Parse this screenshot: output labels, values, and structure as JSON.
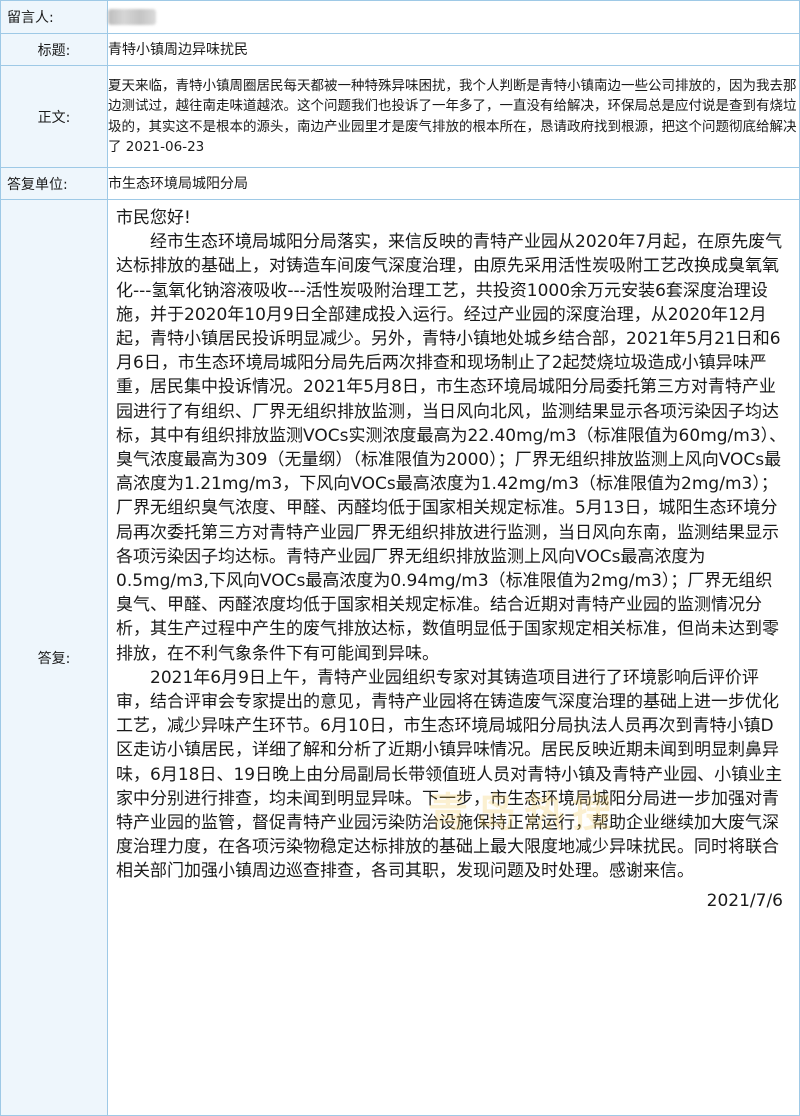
{
  "rows": {
    "author": {
      "label": "留言人:"
    },
    "title": {
      "label": "标题:",
      "value": "青特小镇周边异味扰民"
    },
    "content": {
      "label": "正文:",
      "value": "夏天来临，青特小镇周圈居民每天都被一种特殊异味困扰，我个人判断是青特小镇南边一些公司排放的，因为我去那边测试过，越往南走味道越浓。这个问题我们也投诉了一年多了，一直没有给解决，环保局总是应付说是查到有烧垃圾的，其实这不是根本的源头，南边产业园里才是废气排放的根本所在，恳请政府找到根源，把这个问题彻底给解决了  2021-06-23"
    },
    "unit": {
      "label": "答复单位:",
      "value": "市生态环境局城阳分局"
    },
    "reply": {
      "label": "答复:",
      "greeting": "市民您好!",
      "paragraph1": "经市生态环境局城阳分局落实，来信反映的青特产业园从2020年7月起，在原先废气达标排放的基础上，对铸造车间废气深度治理，由原先采用活性炭吸附工艺改换成臭氧氧化---氢氧化钠溶液吸收---活性炭吸附治理工艺，共投资1000余万元安装6套深度治理设施，并于2020年10月9日全部建成投入运行。经过产业园的深度治理，从2020年12月起，青特小镇居民投诉明显减少。另外，青特小镇地处城乡结合部，2021年5月21日和6月6日，市生态环境局城阳分局先后两次排查和现场制止了2起焚烧垃圾造成小镇异味严重，居民集中投诉情况。2021年5月8日，市生态环境局城阳分局委托第三方对青特产业园进行了有组织、厂界无组织排放监测，当日风向北风，监测结果显示各项污染因子均达标，其中有组织排放监测VOCs实测浓度最高为22.40mg/m3（标准限值为60mg/m3）、臭气浓度最高为309（无量纲）（标准限值为2000）；厂界无组织排放监测上风向VOCs最高浓度为1.21mg/m3，下风向VOCs最高浓度为1.42mg/m3（标准限值为2mg/m3）；厂界无组织臭气浓度、甲醛、丙醛均低于国家相关规定标准。5月13日，城阳生态环境分局再次委托第三方对青特产业园厂界无组织排放进行监测，当日风向东南，监测结果显示各项污染因子均达标。青特产业园厂界无组织排放监测上风向VOCs最高浓度为0.5mg/m3,下风向VOCs最高浓度为0.94mg/m3（标准限值为2mg/m3）；厂界无组织臭气、甲醛、丙醛浓度均低于国家相关规定标准。结合近期对青特产业园的监测情况分析，其生产过程中产生的废气排放达标，数值明显低于国家规定相关标准，但尚未达到零排放，在不利气象条件下有可能闻到异味。",
      "paragraph2": "2021年6月9日上午，青特产业园组织专家对其铸造项目进行了环境影响后评价评审，结合评审会专家提出的意见，青特产业园将在铸造废气深度治理的基础上进一步优化工艺，减少异味产生环节。6月10日，市生态环境局城阳分局执法人员再次到青特小镇D区走访小镇居民，详细了解和分析了近期小镇异味情况。居民反映近期未闻到明显刺鼻异味，6月18日、19日晚上由分局副局长带领值班人员对青特小镇及青特产业园、小镇业主家中分别进行排查，均未闻到明显异味。下一步，市生态环境局城阳分局进一步加强对青特产业园的监管，督促青特产业园污染防治设施保持正常运行，帮助企业继续加大废气深度治理力度，在各项污染物稳定达标排放的基础上最大限度地减少异味扰民。同时将联合相关部门加强小镇周边巡查排查，各司其职，发现问题及时处理。感谢来信。",
      "date": "2021/7/6"
    }
  },
  "watermark": "青岛热搜",
  "colors": {
    "border": "#9ec9e6",
    "label_bg": "#eef6fc"
  }
}
